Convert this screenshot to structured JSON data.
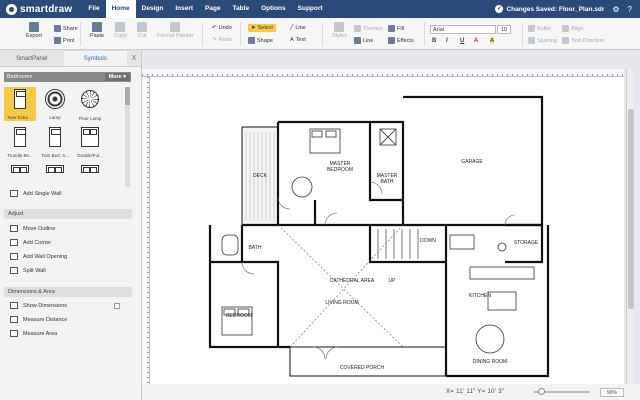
{
  "app": {
    "logo_text": "smartdraw",
    "menu": [
      "File",
      "Home",
      "Design",
      "Insert",
      "Page",
      "Table",
      "Options",
      "Support"
    ],
    "active_menu": "Home",
    "saved_status": "Changes Saved: Floor_Plan.sdr",
    "menubar_icons": [
      "gear-icon",
      "help-icon"
    ]
  },
  "ribbon": {
    "export": "Export",
    "share": "Share",
    "print": "Print",
    "paste": "Paste",
    "copy": "Copy",
    "cut": "Cut",
    "format_painter": "Format Painter",
    "undo": "Undo",
    "redo": "Redo",
    "select": "Select",
    "line": "Line",
    "shape": "Shape",
    "text": "Text",
    "styles": "Styles",
    "themes": "Themes",
    "fill": "Fill",
    "line2": "Line",
    "effects": "Effects",
    "font": "Arial",
    "font_size": "10",
    "format_buttons": [
      "B",
      "I",
      "U",
      "A",
      "A"
    ],
    "bullet": "Bullet",
    "align": "Align",
    "spacing": "Spacing",
    "text_direction": "Text Direction",
    "colors": {
      "menubar": "#2c4a78",
      "select_highlight": "#f7c948"
    }
  },
  "panel": {
    "tabs": [
      "SmartPanel",
      "Symbols"
    ],
    "active_tab": "Symbols",
    "close": "X",
    "library": "Bedrooms",
    "more": "More ▾",
    "symbols": [
      "Twin Extra ...",
      "Lamp",
      "Floor Lamp",
      "Trundle Be...",
      "Twin Bed, S...",
      "Double/Ful..."
    ],
    "add_single_wall": "Add Single Wall",
    "adjust_title": "Adjust",
    "adjust_items": [
      "Move Outline",
      "Add Corner",
      "Add Wall Opening",
      "Split Wall"
    ],
    "dimensions_title": "Dimensions & Area",
    "dimension_items": [
      "Show Dimensions",
      "Measure Distance",
      "Measure Area"
    ]
  },
  "floorplan": {
    "rooms": {
      "deck": "DECK",
      "master_bedroom": "MASTER\nBEDROOM",
      "master_bath": "MASTER\nBATH",
      "garage": "GARAGE",
      "bath": "BATH",
      "down": "DOWN",
      "storage": "STORAGE",
      "cathedral": "CATHEDRAL AREA",
      "up": "UP",
      "living": "LIVING ROOM",
      "bedroom": "BEDROOM",
      "kitchen": "KITCHEN",
      "dining": "DINING ROOM",
      "porch": "COVERED PORCH"
    }
  },
  "status": {
    "coords": "X= 11' 11\"  Y= 10' 3\"",
    "zoom": "90%"
  }
}
